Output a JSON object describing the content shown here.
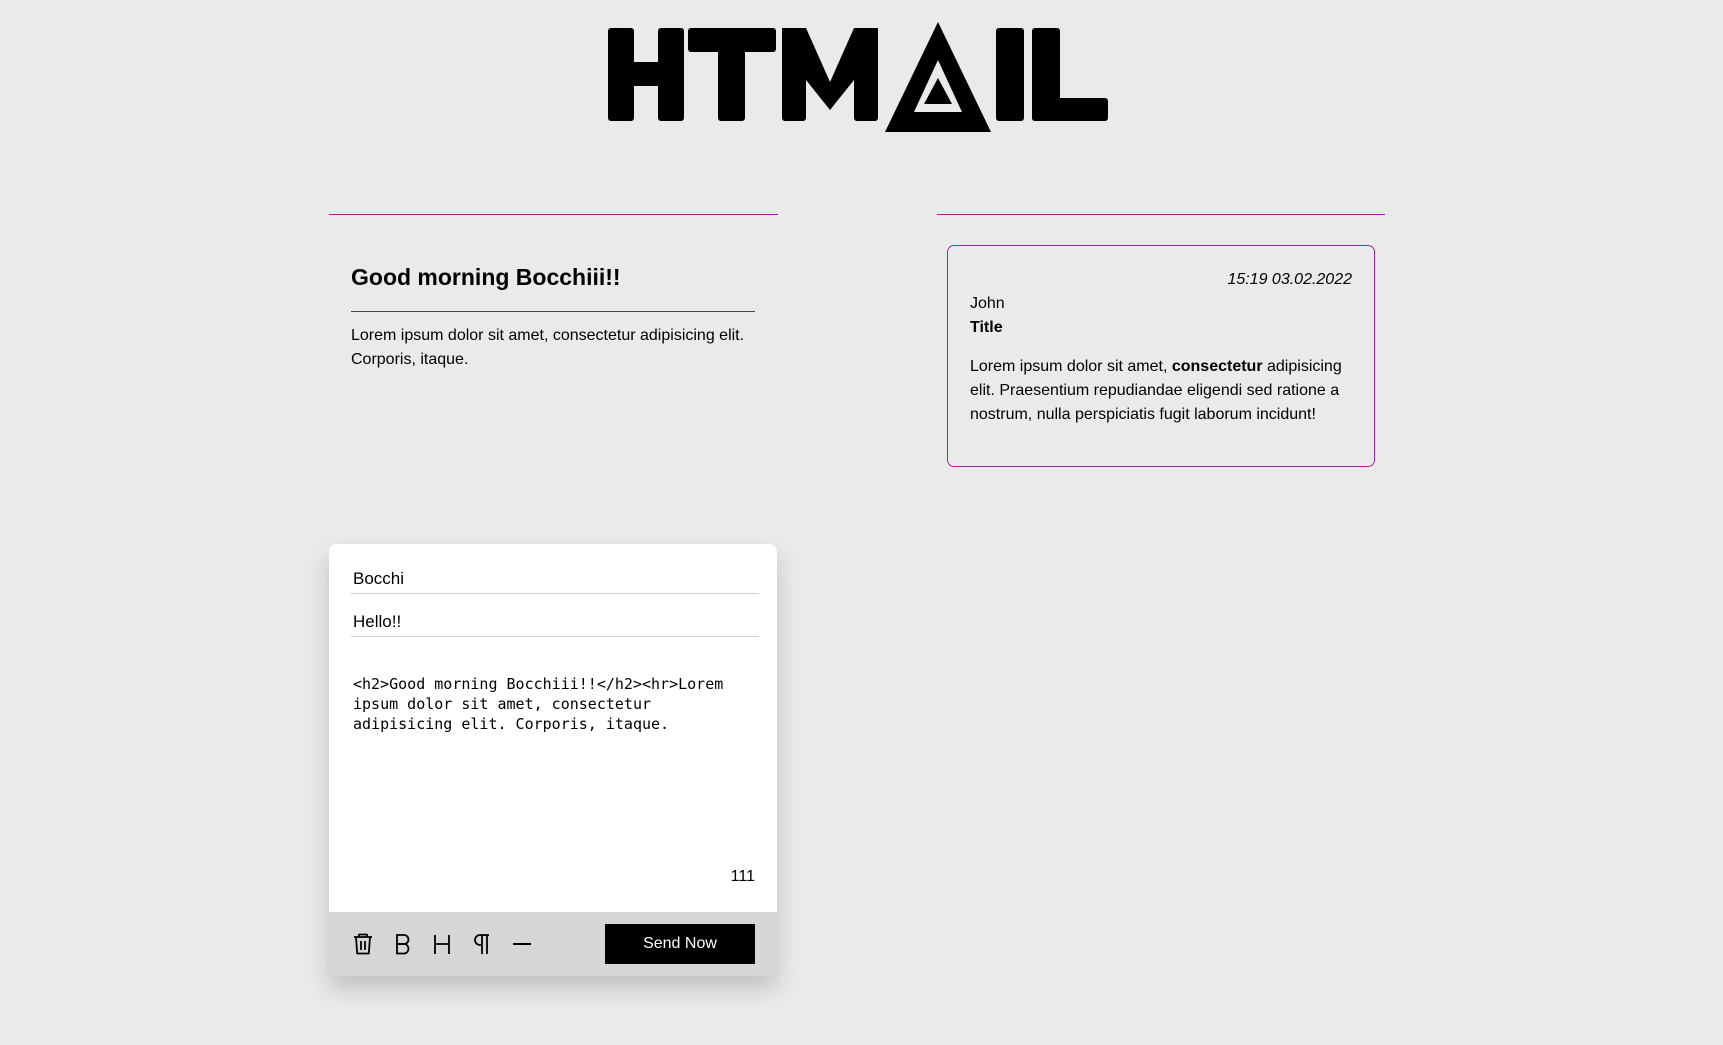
{
  "brand": {
    "logo_text": "HTMAIL"
  },
  "preview": {
    "heading": "Good morning Bocchiii!!",
    "body": "Lorem ipsum dolor sit amet, consectetur adipisicing elit. Corporis, itaque."
  },
  "inbox": {
    "message": {
      "timestamp": "15:19 03.02.2022",
      "sender": "John",
      "title": "Title",
      "body_before": "Lorem ipsum dolor sit amet, ",
      "body_bold": "consectetur",
      "body_after": " adipisicing elit. Praesentium repudiandae eligendi sed ratione a nostrum, nulla perspiciatis fugit laborum incidunt!"
    }
  },
  "compose": {
    "to_value": "Bocchi",
    "subject_value": "Hello!!",
    "body_value": "<h2>Good morning Bocchiii!!</h2><hr>Lorem ipsum dolor sit amet, consectetur adipisicing elit. Corporis, itaque.",
    "char_count": "111",
    "send_label": "Send Now",
    "tools": [
      {
        "name": "trash-icon"
      },
      {
        "name": "bold-icon"
      },
      {
        "name": "heading-icon"
      },
      {
        "name": "paragraph-icon"
      },
      {
        "name": "horizontal-rule-icon"
      }
    ]
  },
  "colors": {
    "background": "#eaeaea",
    "accent": "#a0279f",
    "toolbar": "#d6d6d6",
    "send_button": "#000000"
  }
}
